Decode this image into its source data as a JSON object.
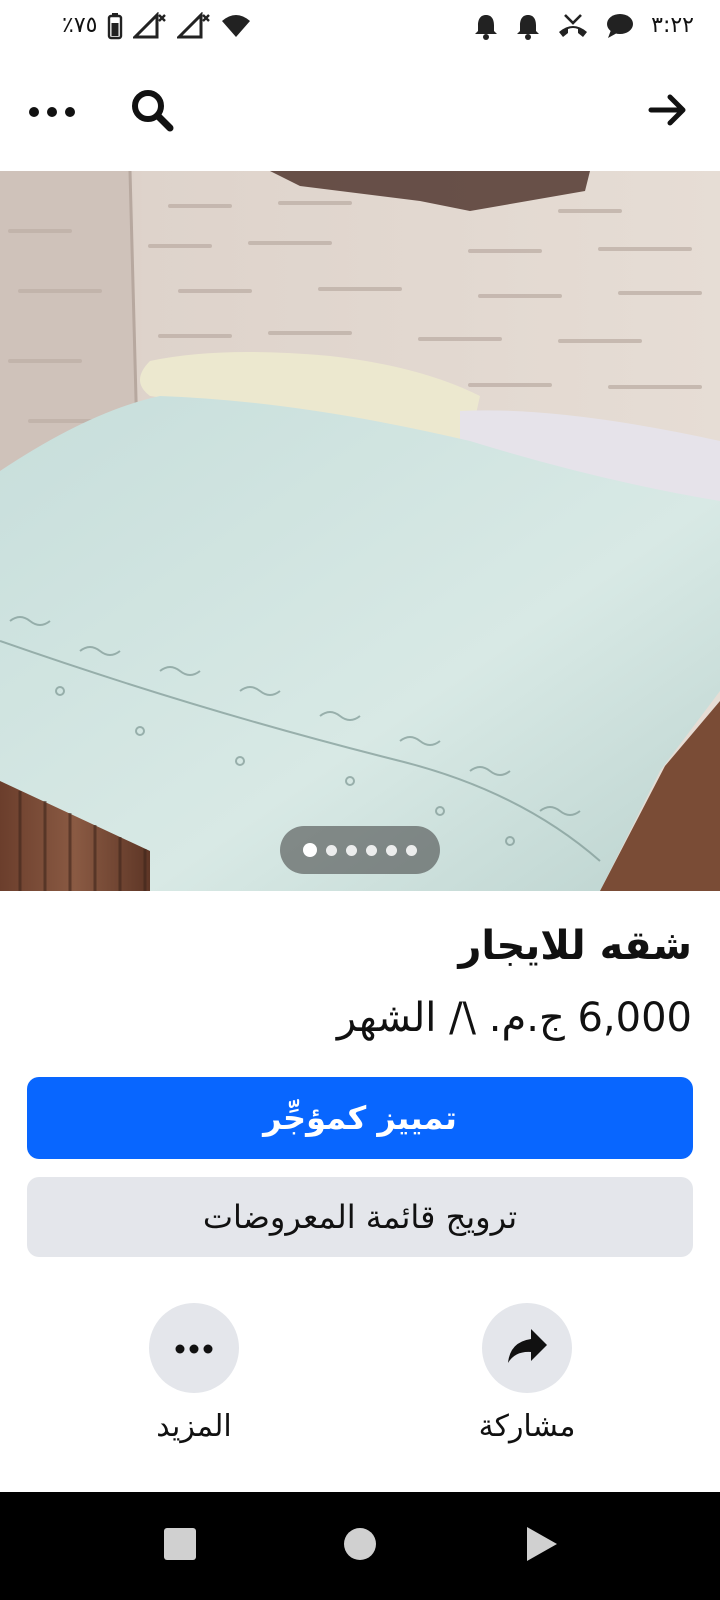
{
  "status_bar": {
    "battery_text": "٪٧٥",
    "time": "٣:٢٢",
    "icons_left": [
      "battery-icon",
      "signal-x-icon",
      "signal-x-icon",
      "wifi-icon"
    ],
    "icons_right": [
      "notification-bell-icon",
      "notification-bell-icon",
      "missed-call-icon",
      "chat-bubble-icon"
    ]
  },
  "app_bar": {
    "icons": [
      "more-icon",
      "search-icon",
      "back-arrow-icon"
    ]
  },
  "gallery": {
    "image": "bed-photo",
    "dot_count": 6,
    "active_index": 0
  },
  "listing": {
    "title": "شقه للايجار",
    "price": "6,000 ج.م. \\/ الشهر"
  },
  "buttons": {
    "primary": "تمييز كمؤجِّر",
    "secondary": "ترويج قائمة المعروضات"
  },
  "actions": {
    "share_label": "مشاركة",
    "more_label": "المزيد"
  },
  "colors": {
    "accent": "#0866ff",
    "secondary_bg": "#e4e6eb",
    "nav_bg": "#000000"
  }
}
